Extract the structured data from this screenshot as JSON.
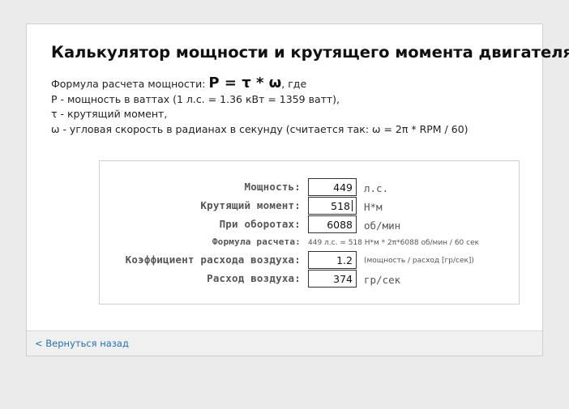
{
  "page": {
    "title": "Калькулятор мощности и крутящего момента двигателя"
  },
  "description": {
    "prefix": "Формула расчета мощности: ",
    "formula": "P = τ * ω",
    "suffix": ", где",
    "line2": "P - мощность в ваттах (1 л.с. = 1.36 кВт = 1359 ватт),",
    "line3": "τ - крутящий момент,",
    "line4": "ω - угловая скорость в радианах в секунду (считается так: ω = 2π * RPM / 60)"
  },
  "calculator": {
    "power": {
      "label": "Мощность:",
      "value": "449",
      "unit": "л.с."
    },
    "torque": {
      "label": "Крутящий момент:",
      "value": "518",
      "unit": "Н*м"
    },
    "rpm": {
      "label": "При оборотах:",
      "value": "6088",
      "unit": "об/мин"
    },
    "formula": {
      "label": "Формула расчета:",
      "text": "449 л.с. = 518 Н*м * 2π*6088 об/мин / 60 сек"
    },
    "air_coeff": {
      "label": "Коэффициент расхода воздуха:",
      "value": "1.2",
      "unit": "(мощность / расход [гр/сек])"
    },
    "airflow": {
      "label": "Расход воздуха:",
      "value": "374",
      "unit": "гр/сек"
    }
  },
  "footer": {
    "back_label": "< Вернуться назад"
  },
  "colors": {
    "background": "#ebebeb",
    "panel": "#ffffff",
    "link": "#2470b8"
  }
}
